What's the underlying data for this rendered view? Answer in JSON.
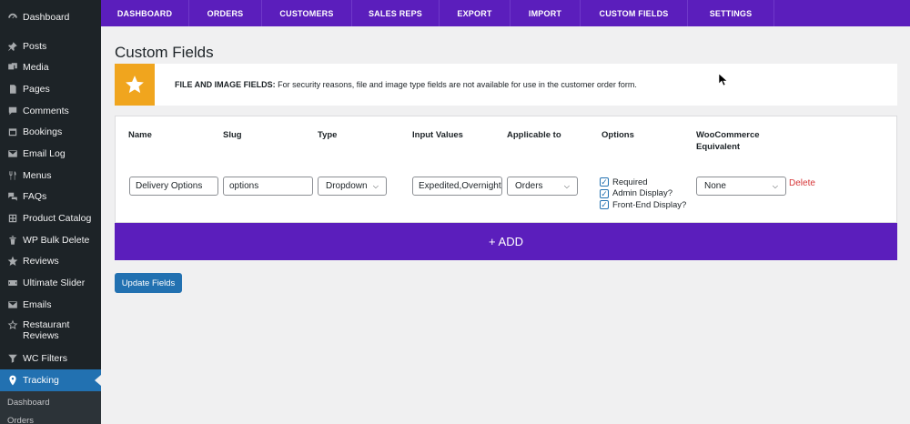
{
  "sidebar": {
    "items": [
      {
        "label": "Dashboard",
        "icon": "dashboard-icon"
      },
      {
        "label": "Posts",
        "icon": "pin-icon"
      },
      {
        "label": "Media",
        "icon": "media-icon"
      },
      {
        "label": "Pages",
        "icon": "pages-icon"
      },
      {
        "label": "Comments",
        "icon": "comments-icon"
      },
      {
        "label": "Bookings",
        "icon": "calendar-icon"
      },
      {
        "label": "Email Log",
        "icon": "email-icon"
      },
      {
        "label": "Menus",
        "icon": "utensils-icon"
      },
      {
        "label": "FAQs",
        "icon": "faq-icon"
      },
      {
        "label": "Product Catalog",
        "icon": "catalog-icon"
      },
      {
        "label": "WP Bulk Delete",
        "icon": "trash-icon"
      },
      {
        "label": "Reviews",
        "icon": "star-icon"
      },
      {
        "label": "Ultimate Slider",
        "icon": "slider-icon"
      },
      {
        "label": "Emails",
        "icon": "email-icon"
      },
      {
        "label": "Restaurant Reviews",
        "icon": "star-outline-icon"
      },
      {
        "label": "WC Filters",
        "icon": "filter-icon"
      },
      {
        "label": "Tracking",
        "icon": "location-icon"
      }
    ],
    "submenu": [
      "Dashboard",
      "Orders"
    ]
  },
  "topnav": [
    "DASHBOARD",
    "ORDERS",
    "CUSTOMERS",
    "SALES REPS",
    "EXPORT",
    "IMPORT",
    "CUSTOM FIELDS",
    "SETTINGS"
  ],
  "page": {
    "title": "Custom Fields",
    "notice_bold": "FILE AND IMAGE FIELDS:",
    "notice_text": " For security reasons, file and image type fields are not available for use in the customer order form."
  },
  "table": {
    "headers": {
      "name": "Name",
      "slug": "Slug",
      "type": "Type",
      "input_values": "Input Values",
      "applicable": "Applicable to",
      "options": "Options",
      "woo_line1": "WooCommerce",
      "woo_line2": "Equivalent"
    },
    "row": {
      "name": "Delivery Options",
      "slug": "options",
      "type": "Dropdown",
      "input_values": "Expedited,Overnight",
      "applicable": "Orders",
      "options": [
        "Required",
        "Admin Display?",
        "Front-End Display?"
      ],
      "woo": "None",
      "delete": "Delete"
    }
  },
  "add_label": "+ ADD",
  "update_label": "Update Fields",
  "colors": {
    "purple": "#5b1ebc",
    "blue": "#2271b1",
    "orange": "#f0a51e",
    "delete": "#d63638"
  }
}
